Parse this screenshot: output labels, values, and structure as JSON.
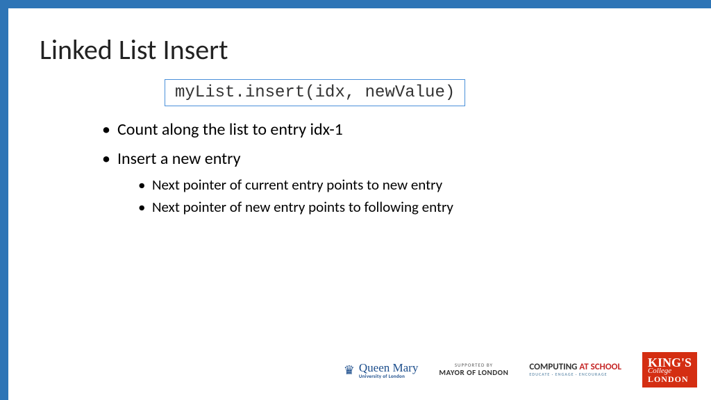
{
  "title": "Linked List Insert",
  "code": "myList.insert(idx, newValue)",
  "bullets": {
    "b1": "Count along the list to entry idx-1",
    "b2": "Insert a new entry",
    "b2sub": {
      "s1": "Next pointer of current entry points to new entry",
      "s2": "Next pointer of new entry points to following entry"
    }
  },
  "logos": {
    "qm": {
      "main": "Queen Mary",
      "sub": "University of London"
    },
    "mayor": {
      "sup": "SUPPORTED BY",
      "main": "MAYOR OF LONDON"
    },
    "cas": {
      "part1": "COMPUTING ",
      "part2": "AT SCHOOL",
      "sub": "EDUCATE · ENGAGE · ENCOURAGE"
    },
    "kcl": {
      "k": "KING'S",
      "c": "College",
      "l": "LONDON"
    }
  }
}
